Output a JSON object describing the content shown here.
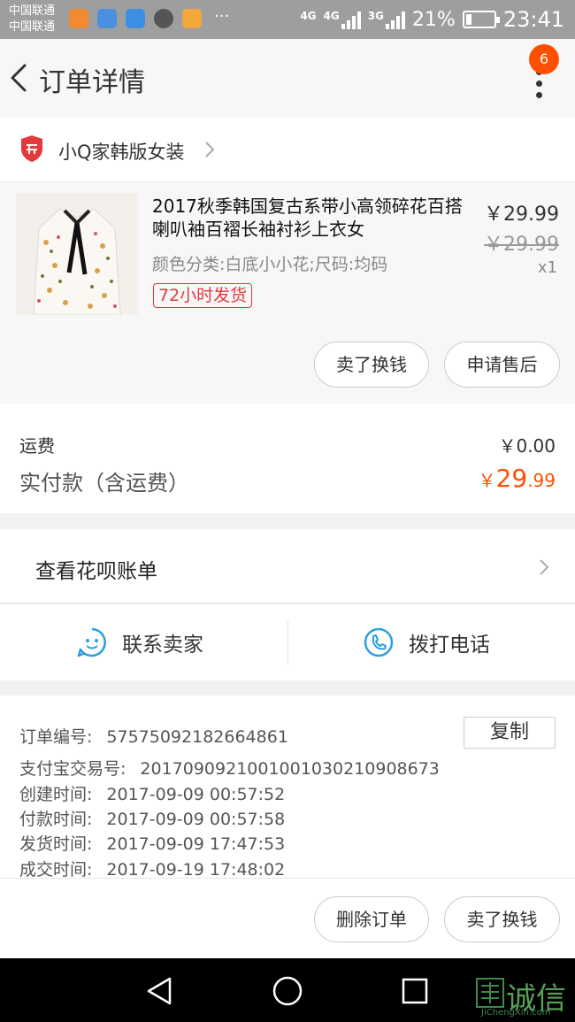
{
  "status_bar": {
    "carrier_1": "中国联通",
    "carrier_2": "中国联通",
    "network_1": "4G",
    "network_2": "4G",
    "network_3": "3G",
    "battery": "21%",
    "time": "23:41",
    "more_dots": "···"
  },
  "header": {
    "title": "订单详情",
    "badge_count": "6"
  },
  "shop": {
    "name": "小Q家韩版女装"
  },
  "product": {
    "title": "2017秋季韩国复古系带小高领碎花百搭喇叭袖百褶长袖衬衫上衣女",
    "sku": "颜色分类:白底小小花;尺码:均码",
    "tag": "72小时发货",
    "price": "￥29.99",
    "original_price": "￥29.99",
    "quantity": "x1",
    "btn_resell": "卖了换钱",
    "btn_aftersale": "申请售后"
  },
  "fees": {
    "shipping_label": "运费",
    "shipping_value": "￥0.00",
    "paid_label": "实付款（含运费）",
    "paid_currency": "￥",
    "paid_int": "29",
    "paid_dec": ".99"
  },
  "bill": {
    "label": "查看花呗账单"
  },
  "contact": {
    "seller": "联系卖家",
    "phone": "拨打电话"
  },
  "order_info": {
    "order_no_label": "订单编号:",
    "order_no": "57575092182664861",
    "copy": "复制",
    "alipay_label": "支付宝交易号:",
    "alipay_no": "2017090921001001030210908673",
    "created_label": "创建时间:",
    "created": "2017-09-09 00:57:52",
    "paid_label": "付款时间:",
    "paid": "2017-09-09 00:57:58",
    "shipped_label": "发货时间:",
    "shipped": "2017-09-09 17:47:53",
    "completed_label": "成交时间:",
    "completed": "2017-09-19 17:48:02"
  },
  "actions": {
    "delete": "删除订单",
    "resell": "卖了换钱"
  },
  "watermark": {
    "name": "诚信",
    "url": "JiChengXin.com"
  },
  "colors": {
    "accent": "#ff5000",
    "tag_red": "#e4393c",
    "link_blue": "#2b9fe0"
  }
}
